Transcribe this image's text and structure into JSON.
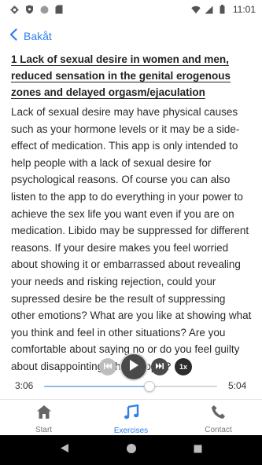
{
  "status_bar": {
    "time": "11:01",
    "icons_left": [
      "gear-icon",
      "shield-icon",
      "circle-icon",
      "sd-card-icon"
    ],
    "icons_right": [
      "wifi-icon",
      "signal-icon",
      "battery-icon"
    ]
  },
  "nav": {
    "back_label": "Bakåt"
  },
  "article": {
    "title": "1 Lack of sexual desire in women and men, reduced sensation in the genital erogenous zones and delayed orgasm/ejaculation",
    "body": "Lack of sexual desire may have physical causes such as your hormone levels or it may be a side-effect of medication. This app is only intended to help people with a lack of sexual desire for psychological reasons. Of course you can also listen to the app to do everything in your power to achieve the sex life you want even if you are on medication. Libido may be suppressed for different reasons. If your desire makes you feel worried about showing it or embarrassed about revealing your needs and risking rejection, could your supressed desire be the result of suppressing other emotions? What are you like at showing what you think and feel in other situations? Are you comfortable about saying no or do you feel guilty about disappointing other people?"
  },
  "player": {
    "current_time": "3:06",
    "total_time": "5:04",
    "progress": 0.61,
    "speed_label": "1x"
  },
  "tabs": [
    {
      "label": "Start",
      "icon": "home-icon",
      "active": false
    },
    {
      "label": "Exercises",
      "icon": "music-note-icon",
      "active": true
    },
    {
      "label": "Contact",
      "icon": "phone-icon",
      "active": false
    }
  ],
  "colors": {
    "accent": "#2f80ed",
    "progress_fill": "#8fbbe8"
  }
}
